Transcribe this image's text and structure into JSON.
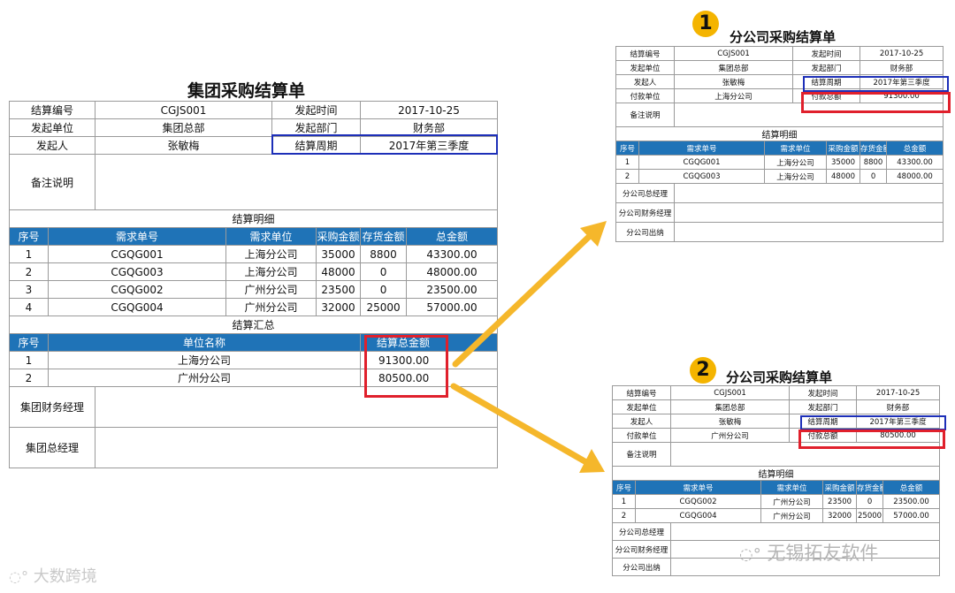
{
  "main": {
    "title": "集团采购结算单",
    "labels": {
      "code": "结算编号",
      "start_time": "发起时间",
      "start_unit": "发起单位",
      "start_dept": "发起部门",
      "initiator": "发起人",
      "period": "结算周期",
      "remark": "备注说明"
    },
    "values": {
      "code": "CGJS001",
      "start_time": "2017-10-25",
      "start_unit": "集团总部",
      "start_dept": "财务部",
      "initiator": "张敏梅",
      "period": "2017年第三季度"
    },
    "detail_title": "结算明细",
    "detail_headers": [
      "序号",
      "需求单号",
      "需求单位",
      "采购金额",
      "存货金额",
      "总金额"
    ],
    "detail_rows": [
      [
        "1",
        "CGQG001",
        "上海分公司",
        "35000",
        "8800",
        "43300.00"
      ],
      [
        "2",
        "CGQG003",
        "上海分公司",
        "48000",
        "0",
        "48000.00"
      ],
      [
        "3",
        "CGQG002",
        "广州分公司",
        "23500",
        "0",
        "23500.00"
      ],
      [
        "4",
        "CGQG004",
        "广州分公司",
        "32000",
        "25000",
        "57000.00"
      ]
    ],
    "summary_title": "结算汇总",
    "summary_headers": [
      "序号",
      "单位名称",
      "结算总金额"
    ],
    "summary_rows": [
      [
        "1",
        "上海分公司",
        "91300.00"
      ],
      [
        "2",
        "广州分公司",
        "80500.00"
      ]
    ],
    "sign1": "集团财务经理",
    "sign2": "集团总经理"
  },
  "branch1": {
    "badge": "1",
    "title": "分公司采购结算单",
    "labels": {
      "code": "结算编号",
      "start_time": "发起时间",
      "start_unit": "发起单位",
      "start_dept": "发起部门",
      "initiator": "发起人",
      "period": "结算周期",
      "pay_unit": "付款单位",
      "pay_total": "付款总额",
      "remark": "备注说明"
    },
    "values": {
      "code": "CGJS001",
      "start_time": "2017-10-25",
      "start_unit": "集团总部",
      "start_dept": "财务部",
      "initiator": "张敏梅",
      "period": "2017年第三季度",
      "pay_unit": "上海分公司",
      "pay_total": "91300.00"
    },
    "detail_title": "结算明细",
    "detail_headers": [
      "序号",
      "需求单号",
      "需求单位",
      "采购金额",
      "存货金额",
      "总金额"
    ],
    "detail_rows": [
      [
        "1",
        "CGQG001",
        "上海分公司",
        "35000",
        "8800",
        "43300.00"
      ],
      [
        "2",
        "CGQG003",
        "上海分公司",
        "48000",
        "0",
        "48000.00"
      ]
    ],
    "sign1": "分公司总经理",
    "sign2": "分公司财务经理",
    "sign3": "分公司出纳"
  },
  "branch2": {
    "badge": "2",
    "title": "分公司采购结算单",
    "labels": {
      "code": "结算编号",
      "start_time": "发起时间",
      "start_unit": "发起单位",
      "start_dept": "发起部门",
      "initiator": "发起人",
      "period": "结算周期",
      "pay_unit": "付款单位",
      "pay_total": "付款总额",
      "remark": "备注说明"
    },
    "values": {
      "code": "CGJS001",
      "start_time": "2017-10-25",
      "start_unit": "集团总部",
      "start_dept": "财务部",
      "initiator": "张敏梅",
      "period": "2017年第三季度",
      "pay_unit": "广州分公司",
      "pay_total": "80500.00"
    },
    "detail_title": "结算明细",
    "detail_headers": [
      "序号",
      "需求单号",
      "需求单位",
      "采购金额",
      "存货金额",
      "总金额"
    ],
    "detail_rows": [
      [
        "1",
        "CGQG002",
        "广州分公司",
        "23500",
        "0",
        "23500.00"
      ],
      [
        "2",
        "CGQG004",
        "广州分公司",
        "32000",
        "25000",
        "57000.00"
      ]
    ],
    "sign1": "分公司总经理",
    "sign2": "分公司财务经理",
    "sign3": "分公司出纳"
  },
  "watermarks": {
    "left": "大数跨境",
    "right": "无锡拓友软件"
  },
  "colors": {
    "header_blue": "#1f73b7",
    "highlight_red": "#e0202c",
    "highlight_blue": "#1d2fb8",
    "arrow_yellow": "#f5b72b",
    "badge_yellow": "#f4b400"
  }
}
